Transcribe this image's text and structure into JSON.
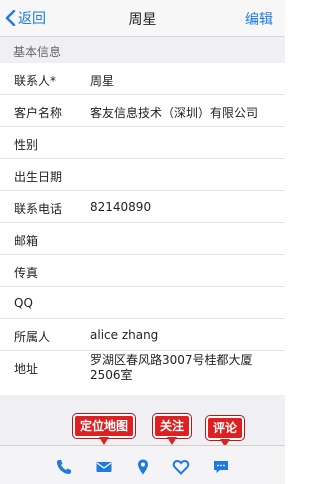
{
  "nav": {
    "back_label": "返回",
    "title": "周星",
    "edit_label": "编辑"
  },
  "section": {
    "title": "基本信息"
  },
  "fields": [
    {
      "label": "联系人*",
      "value": "周星"
    },
    {
      "label": "客户名称",
      "value": "客友信息技术（深圳）有限公司"
    },
    {
      "label": "性别",
      "value": ""
    },
    {
      "label": "出生日期",
      "value": ""
    },
    {
      "label": "联系电话",
      "value": "82140890"
    },
    {
      "label": "邮箱",
      "value": ""
    },
    {
      "label": "传真",
      "value": ""
    },
    {
      "label": "QQ",
      "value": ""
    },
    {
      "label": "所属人",
      "value": "alice zhang"
    },
    {
      "label": "地址",
      "value": "罗湖区春风路3007号桂都大厦2506室"
    }
  ],
  "callouts": {
    "map": "定位地图",
    "follow": "关注",
    "comment": "评论"
  },
  "toolbar": {
    "icons": [
      "phone-icon",
      "mail-icon",
      "location-pin-icon",
      "heart-icon",
      "comment-icon"
    ]
  },
  "colors": {
    "accent": "#1f7ae0",
    "callout": "#e02020",
    "section_bg": "#efeff4"
  }
}
